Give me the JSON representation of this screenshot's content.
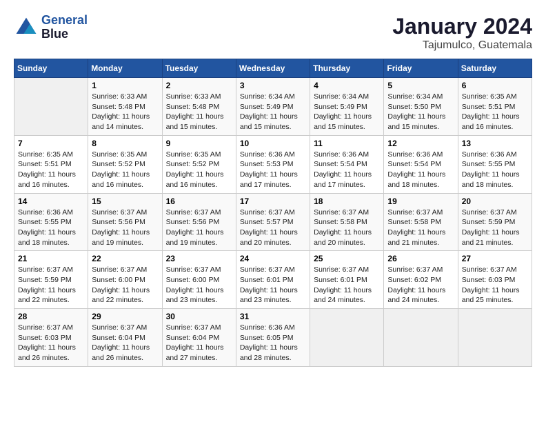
{
  "header": {
    "logo_line1": "General",
    "logo_line2": "Blue",
    "title": "January 2024",
    "subtitle": "Tajumulco, Guatemala"
  },
  "weekdays": [
    "Sunday",
    "Monday",
    "Tuesday",
    "Wednesday",
    "Thursday",
    "Friday",
    "Saturday"
  ],
  "weeks": [
    [
      {
        "day": "",
        "empty": true
      },
      {
        "day": "1",
        "sunrise": "6:33 AM",
        "sunset": "5:48 PM",
        "daylight": "11 hours and 14 minutes."
      },
      {
        "day": "2",
        "sunrise": "6:33 AM",
        "sunset": "5:48 PM",
        "daylight": "11 hours and 15 minutes."
      },
      {
        "day": "3",
        "sunrise": "6:34 AM",
        "sunset": "5:49 PM",
        "daylight": "11 hours and 15 minutes."
      },
      {
        "day": "4",
        "sunrise": "6:34 AM",
        "sunset": "5:49 PM",
        "daylight": "11 hours and 15 minutes."
      },
      {
        "day": "5",
        "sunrise": "6:34 AM",
        "sunset": "5:50 PM",
        "daylight": "11 hours and 15 minutes."
      },
      {
        "day": "6",
        "sunrise": "6:35 AM",
        "sunset": "5:51 PM",
        "daylight": "11 hours and 16 minutes."
      }
    ],
    [
      {
        "day": "7",
        "sunrise": "6:35 AM",
        "sunset": "5:51 PM",
        "daylight": "11 hours and 16 minutes."
      },
      {
        "day": "8",
        "sunrise": "6:35 AM",
        "sunset": "5:52 PM",
        "daylight": "11 hours and 16 minutes."
      },
      {
        "day": "9",
        "sunrise": "6:35 AM",
        "sunset": "5:52 PM",
        "daylight": "11 hours and 16 minutes."
      },
      {
        "day": "10",
        "sunrise": "6:36 AM",
        "sunset": "5:53 PM",
        "daylight": "11 hours and 17 minutes."
      },
      {
        "day": "11",
        "sunrise": "6:36 AM",
        "sunset": "5:54 PM",
        "daylight": "11 hours and 17 minutes."
      },
      {
        "day": "12",
        "sunrise": "6:36 AM",
        "sunset": "5:54 PM",
        "daylight": "11 hours and 18 minutes."
      },
      {
        "day": "13",
        "sunrise": "6:36 AM",
        "sunset": "5:55 PM",
        "daylight": "11 hours and 18 minutes."
      }
    ],
    [
      {
        "day": "14",
        "sunrise": "6:36 AM",
        "sunset": "5:55 PM",
        "daylight": "11 hours and 18 minutes."
      },
      {
        "day": "15",
        "sunrise": "6:37 AM",
        "sunset": "5:56 PM",
        "daylight": "11 hours and 19 minutes."
      },
      {
        "day": "16",
        "sunrise": "6:37 AM",
        "sunset": "5:56 PM",
        "daylight": "11 hours and 19 minutes."
      },
      {
        "day": "17",
        "sunrise": "6:37 AM",
        "sunset": "5:57 PM",
        "daylight": "11 hours and 20 minutes."
      },
      {
        "day": "18",
        "sunrise": "6:37 AM",
        "sunset": "5:58 PM",
        "daylight": "11 hours and 20 minutes."
      },
      {
        "day": "19",
        "sunrise": "6:37 AM",
        "sunset": "5:58 PM",
        "daylight": "11 hours and 21 minutes."
      },
      {
        "day": "20",
        "sunrise": "6:37 AM",
        "sunset": "5:59 PM",
        "daylight": "11 hours and 21 minutes."
      }
    ],
    [
      {
        "day": "21",
        "sunrise": "6:37 AM",
        "sunset": "5:59 PM",
        "daylight": "11 hours and 22 minutes."
      },
      {
        "day": "22",
        "sunrise": "6:37 AM",
        "sunset": "6:00 PM",
        "daylight": "11 hours and 22 minutes."
      },
      {
        "day": "23",
        "sunrise": "6:37 AM",
        "sunset": "6:00 PM",
        "daylight": "11 hours and 23 minutes."
      },
      {
        "day": "24",
        "sunrise": "6:37 AM",
        "sunset": "6:01 PM",
        "daylight": "11 hours and 23 minutes."
      },
      {
        "day": "25",
        "sunrise": "6:37 AM",
        "sunset": "6:01 PM",
        "daylight": "11 hours and 24 minutes."
      },
      {
        "day": "26",
        "sunrise": "6:37 AM",
        "sunset": "6:02 PM",
        "daylight": "11 hours and 24 minutes."
      },
      {
        "day": "27",
        "sunrise": "6:37 AM",
        "sunset": "6:03 PM",
        "daylight": "11 hours and 25 minutes."
      }
    ],
    [
      {
        "day": "28",
        "sunrise": "6:37 AM",
        "sunset": "6:03 PM",
        "daylight": "11 hours and 26 minutes."
      },
      {
        "day": "29",
        "sunrise": "6:37 AM",
        "sunset": "6:04 PM",
        "daylight": "11 hours and 26 minutes."
      },
      {
        "day": "30",
        "sunrise": "6:37 AM",
        "sunset": "6:04 PM",
        "daylight": "11 hours and 27 minutes."
      },
      {
        "day": "31",
        "sunrise": "6:36 AM",
        "sunset": "6:05 PM",
        "daylight": "11 hours and 28 minutes."
      },
      {
        "day": "",
        "empty": true
      },
      {
        "day": "",
        "empty": true
      },
      {
        "day": "",
        "empty": true
      }
    ]
  ]
}
